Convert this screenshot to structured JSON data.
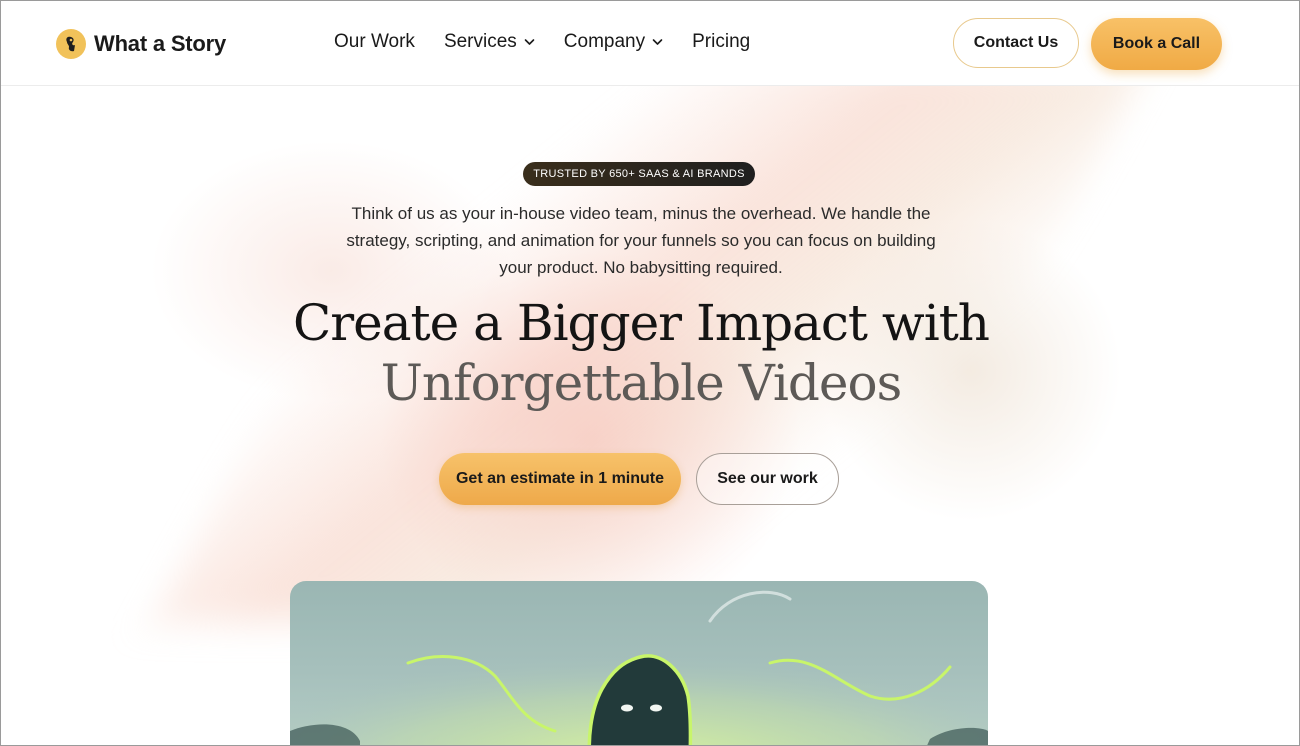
{
  "nav": {
    "brand": "What a Story",
    "links": [
      {
        "label": "Our Work",
        "has_dropdown": false
      },
      {
        "label": "Services",
        "has_dropdown": true
      },
      {
        "label": "Company",
        "has_dropdown": true
      },
      {
        "label": "Pricing",
        "has_dropdown": false
      }
    ],
    "contact_label": "Contact Us",
    "book_label": "Book a Call"
  },
  "hero": {
    "badge": "TRUSTED BY 650+ SAAS & AI BRANDS",
    "subtitle_lines": [
      "Think of us as your in-house video team, minus the overhead. We handle the",
      "strategy, scripting, and animation for your funnels so you can focus on building",
      "your product. No babysitting required."
    ],
    "headline_line1": "Create a Bigger Impact with",
    "headline_line2": "Unforgettable Videos",
    "primary_cta": "Get an estimate in 1 minute",
    "secondary_cta": "See our work"
  },
  "colors": {
    "accent": "#f0aa45",
    "accent_light": "#f8c167",
    "text": "#1a1a1a",
    "headline_muted": "#5d5a57",
    "badge_bg": "#2a2419",
    "video_bg": "#9ab6b3",
    "video_glow": "#c6f06a",
    "character": "#223a3a"
  },
  "icons": [
    "brand-logo-icon",
    "chevron-down-icon",
    "video-character-illustration"
  ]
}
